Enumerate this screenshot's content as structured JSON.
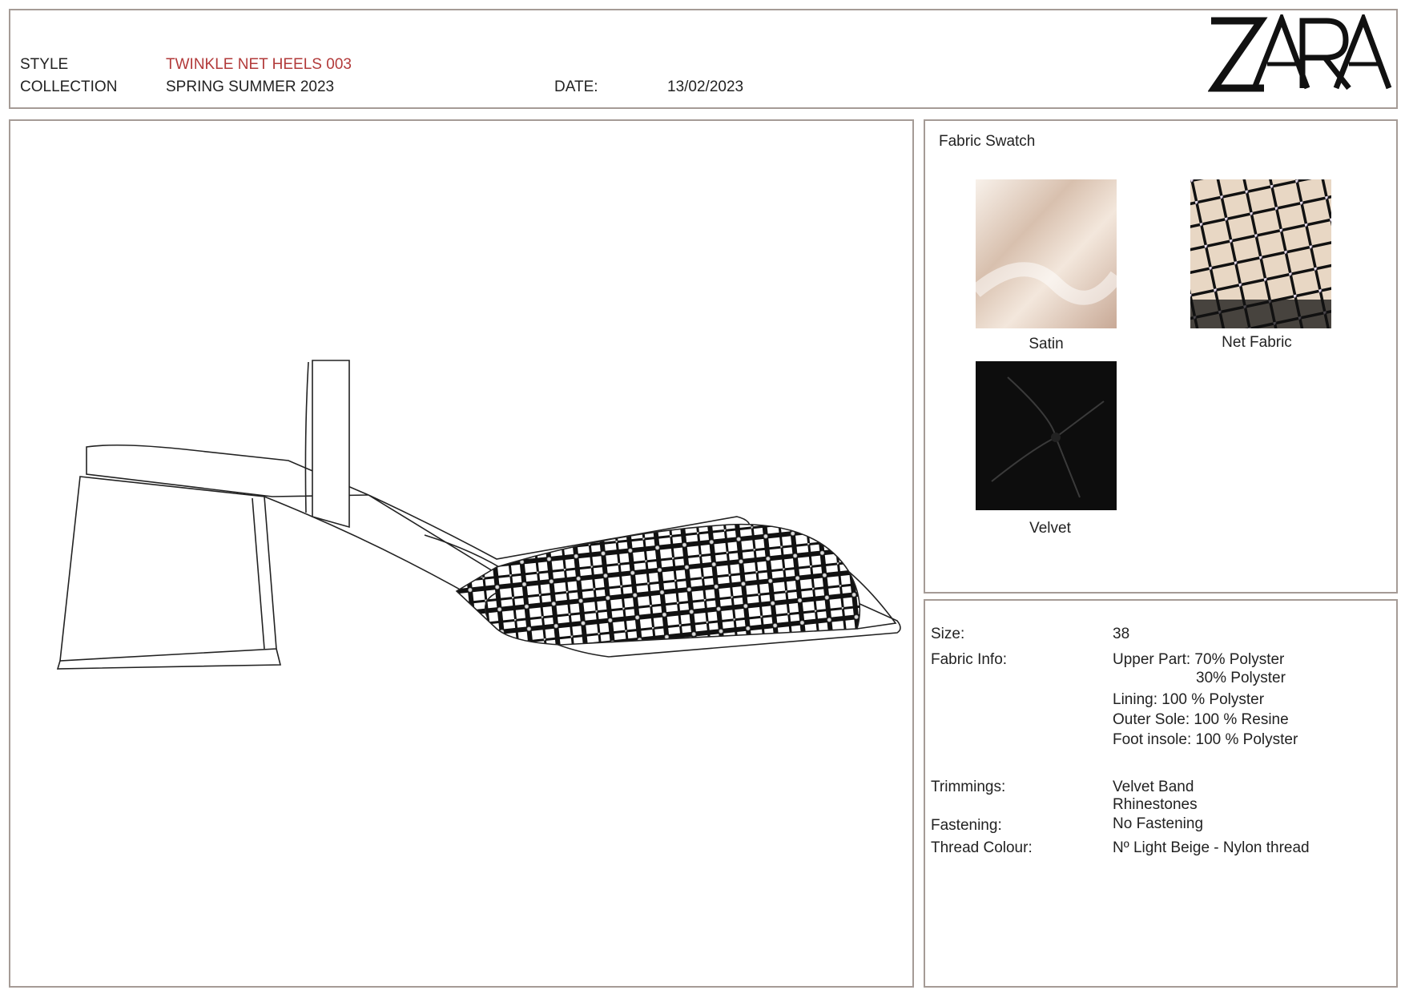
{
  "header": {
    "style_label": "STYLE",
    "style_value": "TWINKLE NET HEELS 003",
    "collection_label": "COLLECTION",
    "collection_value": "SPRING SUMMER 2023",
    "date_label": "DATE:",
    "date_value": "13/02/2023",
    "brand_logo": "ZARA"
  },
  "swatches": {
    "title": "Fabric Swatch",
    "items": [
      {
        "label": "Satin",
        "color": "#e9d6c8"
      },
      {
        "label": "Net Fabric",
        "color": "#1a1a1a"
      },
      {
        "label": "Velvet",
        "color": "#0d0d0d"
      }
    ]
  },
  "specs": {
    "size_label": "Size:",
    "size_value": "38",
    "fabric_label": "Fabric Info:",
    "fabric_upper": "Upper Part: 70% Polyster",
    "fabric_upper2": "30% Polyster",
    "fabric_lining": "Lining: 100 % Polyster",
    "fabric_outer": "Outer Sole: 100 % Resine",
    "fabric_foot": "Foot insole: 100 % Polyster",
    "trim_label": "Trimmings:",
    "trim_1": "Velvet Band",
    "trim_2": "Rhinestones",
    "fastening_label": "Fastening:",
    "fastening_value": "No Fastening",
    "thread_label": "Thread Colour:",
    "thread_value": "Nº Light Beige - Nylon thread"
  },
  "colors": {
    "border": "#a59b96",
    "style_text": "#b23a3a"
  }
}
